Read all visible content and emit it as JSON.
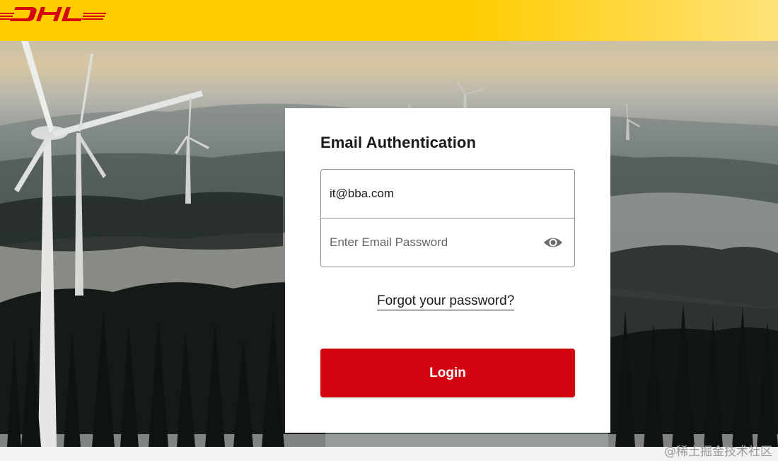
{
  "header": {
    "brand_color": "#ffcc00",
    "logo_text": "DHL",
    "logo_color": "#d40511"
  },
  "auth_card": {
    "title": "Email Authentication",
    "email_field": {
      "value": "it@bba.com",
      "placeholder": ""
    },
    "password_field": {
      "value": "",
      "placeholder": "Enter Email Password",
      "visibility_icon": "eye-icon"
    },
    "forgot_password_label": "Forgot your password?",
    "login_button_label": "Login",
    "login_button_color": "#d40511"
  },
  "watermark": {
    "text": "@稀土掘金技术社区"
  }
}
